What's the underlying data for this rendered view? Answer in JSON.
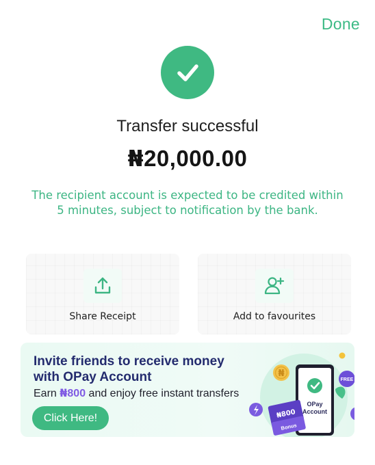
{
  "header": {
    "done_label": "Done"
  },
  "result": {
    "icon": "check-icon",
    "title": "Transfer successful",
    "amount_symbol": "₦",
    "amount_value": "20,000.00",
    "notice": "The recipient account is expected to be credited within 5 minutes, subject to notification by the bank."
  },
  "actions": [
    {
      "label": "Share Receipt",
      "icon": "share-upload-icon"
    },
    {
      "label": "Add to favourites",
      "icon": "add-user-icon"
    }
  ],
  "banner": {
    "title": "Invite friends to receive money with OPay Account",
    "sub_prefix": "Earn ",
    "sub_symbol": "₦",
    "sub_amount": "800",
    "sub_suffix": " and enjoy free instant transfers",
    "button_label": "Click Here!",
    "art": {
      "free_badge": "FREE",
      "phone_text_line1": "OPay",
      "phone_text_line2": "Account",
      "ticket_amount": "₦800",
      "bonus_label": "Bonus",
      "coin_symbol": "₦"
    }
  },
  "colors": {
    "brand_green": "#3fb982",
    "notice_green": "#3cb583",
    "banner_title": "#232b6e",
    "accent_purple": "#7f5ae3"
  }
}
